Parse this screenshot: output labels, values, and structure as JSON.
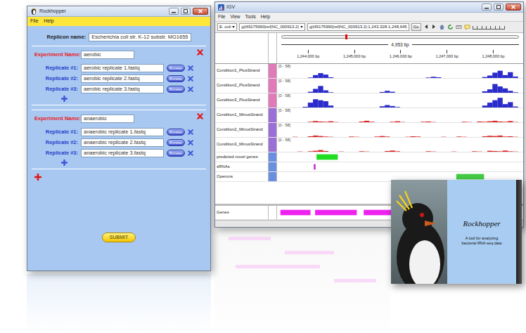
{
  "rockhopper": {
    "title": "Rockhopper",
    "menu": [
      "File",
      "Help"
    ],
    "replicon": {
      "label": "Replicon name:",
      "value": "Escherichia coli str. K-12 substr. MG1655"
    },
    "experiments": [
      {
        "label": "Experiment Name:",
        "value": "aerobic",
        "replicates": [
          {
            "label": "Replicate #1:",
            "value": "aerobic replicate 1.fastq",
            "button": "Browse"
          },
          {
            "label": "Replicate #2:",
            "value": "aerobic replicate 2.fastq",
            "button": "Browse"
          },
          {
            "label": "Replicate #3:",
            "value": "aerobic replicate 3.fastq",
            "button": "Browse"
          }
        ]
      },
      {
        "label": "Experiment Name:",
        "value": "anaerobic",
        "replicates": [
          {
            "label": "Replicate #1:",
            "value": "anaerobic replicate 1.fastq",
            "button": "Browse"
          },
          {
            "label": "Replicate #2:",
            "value": "anaerobic replicate 2.fastq",
            "button": "Browse"
          },
          {
            "label": "Replicate #3:",
            "value": "anaerobic replicate 3.fastq",
            "button": "Browse"
          }
        ]
      }
    ],
    "submit": "SUBMIT"
  },
  "igv": {
    "title": "IGV",
    "menu": [
      "File",
      "View",
      "Tools",
      "Help"
    ],
    "genome": "E. coli",
    "chromosome": "gi|49175990|ref|NC_000913.2|",
    "locus": "gi|49175990|ref|NC_000913.2|:1,243,328-1,248,645",
    "go": "Go",
    "span": "4,953 bp",
    "genome_length": 4639675,
    "range": {
      "start": 1243328,
      "end": 1248645
    },
    "ticks": [
      {
        "label": "1,244,000 bp",
        "bp": 1244000
      },
      {
        "label": "1,245,000 bp",
        "bp": 1245000
      },
      {
        "label": "1,246,000 bp",
        "bp": 1246000
      },
      {
        "label": "1,247,000 bp",
        "bp": 1247000
      },
      {
        "label": "1,248,000 bp",
        "bp": 1248000
      }
    ],
    "tracks": [
      {
        "name": "Condition1_PlusStrand",
        "kind": "coverage",
        "scale": "[0 - 58]",
        "max": 58,
        "color": "#2b2bcc",
        "attr_color": "#e07ab8",
        "values": [
          0,
          0,
          0,
          0,
          0,
          0,
          2,
          12,
          20,
          14,
          3,
          0,
          0,
          0,
          0,
          0,
          0,
          0,
          0,
          0,
          0,
          0,
          0,
          0,
          0,
          0,
          0,
          0,
          0,
          2,
          5,
          3,
          0,
          0,
          0,
          0,
          0,
          0,
          0,
          0,
          4,
          10,
          22,
          30,
          12,
          24,
          6,
          0
        ]
      },
      {
        "name": "Condition2_PlusStrand",
        "kind": "coverage",
        "scale": "[0 - 58]",
        "max": 58,
        "color": "#2b2bcc",
        "attr_color": "#e07ab8",
        "values": [
          0,
          0,
          0,
          0,
          0,
          0,
          4,
          16,
          28,
          10,
          2,
          0,
          0,
          0,
          0,
          0,
          0,
          0,
          0,
          0,
          3,
          8,
          4,
          0,
          0,
          0,
          0,
          0,
          0,
          0,
          0,
          0,
          0,
          0,
          0,
          0,
          0,
          0,
          0,
          0,
          6,
          14,
          36,
          26,
          18,
          8,
          2,
          0
        ]
      },
      {
        "name": "Condition3_PlusStrand",
        "kind": "coverage",
        "scale": "[0 - 58]",
        "max": 58,
        "color": "#2b2bcc",
        "attr_color": "#e07ab8",
        "values": [
          0,
          0,
          0,
          0,
          0,
          3,
          20,
          34,
          30,
          26,
          8,
          0,
          0,
          0,
          0,
          0,
          0,
          0,
          0,
          0,
          5,
          10,
          6,
          2,
          0,
          0,
          0,
          0,
          0,
          0,
          0,
          0,
          0,
          0,
          0,
          0,
          0,
          0,
          0,
          0,
          8,
          20,
          30,
          40,
          14,
          22,
          4,
          0
        ]
      },
      {
        "name": "Condition1_MinusStrand",
        "kind": "coverage",
        "scale": "[0 - 58]",
        "max": 58,
        "color": "#dd2222",
        "attr_color": "#9b6fd6",
        "values": [
          0,
          0,
          0,
          0,
          0,
          0,
          2,
          5,
          3,
          2,
          4,
          1,
          0,
          0,
          0,
          0,
          3,
          6,
          2,
          0,
          0,
          0,
          2,
          4,
          1,
          0,
          0,
          0,
          2,
          3,
          1,
          0,
          0,
          0,
          0,
          0,
          2,
          1,
          0,
          3,
          2,
          4,
          6,
          3,
          2,
          5,
          1,
          0
        ]
      },
      {
        "name": "Condition2_MinusStrand",
        "kind": "coverage",
        "scale": "[0 - 58]",
        "max": 58,
        "color": "#dd2222",
        "attr_color": "#9b6fd6",
        "values": [
          0,
          0,
          0,
          1,
          0,
          0,
          3,
          6,
          4,
          2,
          1,
          0,
          0,
          0,
          2,
          1,
          0,
          0,
          0,
          2,
          4,
          2,
          0,
          0,
          0,
          1,
          3,
          2,
          0,
          0,
          0,
          0,
          1,
          0,
          0,
          2,
          1,
          0,
          0,
          0,
          3,
          5,
          4,
          6,
          2,
          3,
          1,
          0
        ]
      },
      {
        "name": "Condition3_MinusStrand",
        "kind": "coverage",
        "scale": "[0 - 58]",
        "max": 58,
        "color": "#dd2222",
        "attr_color": "#9b6fd6",
        "values": [
          0,
          0,
          0,
          0,
          1,
          0,
          2,
          4,
          7,
          3,
          0,
          0,
          1,
          0,
          0,
          0,
          2,
          1,
          0,
          0,
          0,
          3,
          5,
          2,
          0,
          0,
          0,
          0,
          0,
          2,
          1,
          0,
          0,
          0,
          1,
          0,
          0,
          0,
          2,
          1,
          0,
          4,
          3,
          2,
          5,
          2,
          1,
          0
        ]
      },
      {
        "name": "predicted novel genes",
        "kind": "feature",
        "color": "#22dd22",
        "attr_color": "#6a8fe0",
        "features": [
          {
            "start": 1244180,
            "end": 1244640
          }
        ]
      },
      {
        "name": "sRNAs",
        "kind": "feature",
        "color": "#cc33cc",
        "attr_color": "#6a8fe0",
        "features": [
          {
            "start": 1244120,
            "end": 1244160
          }
        ]
      },
      {
        "name": "Operons",
        "kind": "feature",
        "color": "#44cc44",
        "attr_color": "#6a8fe0",
        "features": [
          {
            "start": 1247200,
            "end": 1247800
          }
        ]
      }
    ],
    "gene_track": {
      "name": "Genes",
      "color": "#ee22ee",
      "features": [
        {
          "start": 1243400,
          "end": 1244050
        },
        {
          "start": 1244150,
          "end": 1245050
        },
        {
          "start": 1245200,
          "end": 1245950
        },
        {
          "start": 1246150,
          "end": 1246900
        },
        {
          "start": 1247000,
          "end": 1248100
        }
      ]
    }
  },
  "splash": {
    "title": "Rockhopper",
    "lines": [
      "A tool for analyzing",
      "bacterial RNA-seq data"
    ]
  }
}
